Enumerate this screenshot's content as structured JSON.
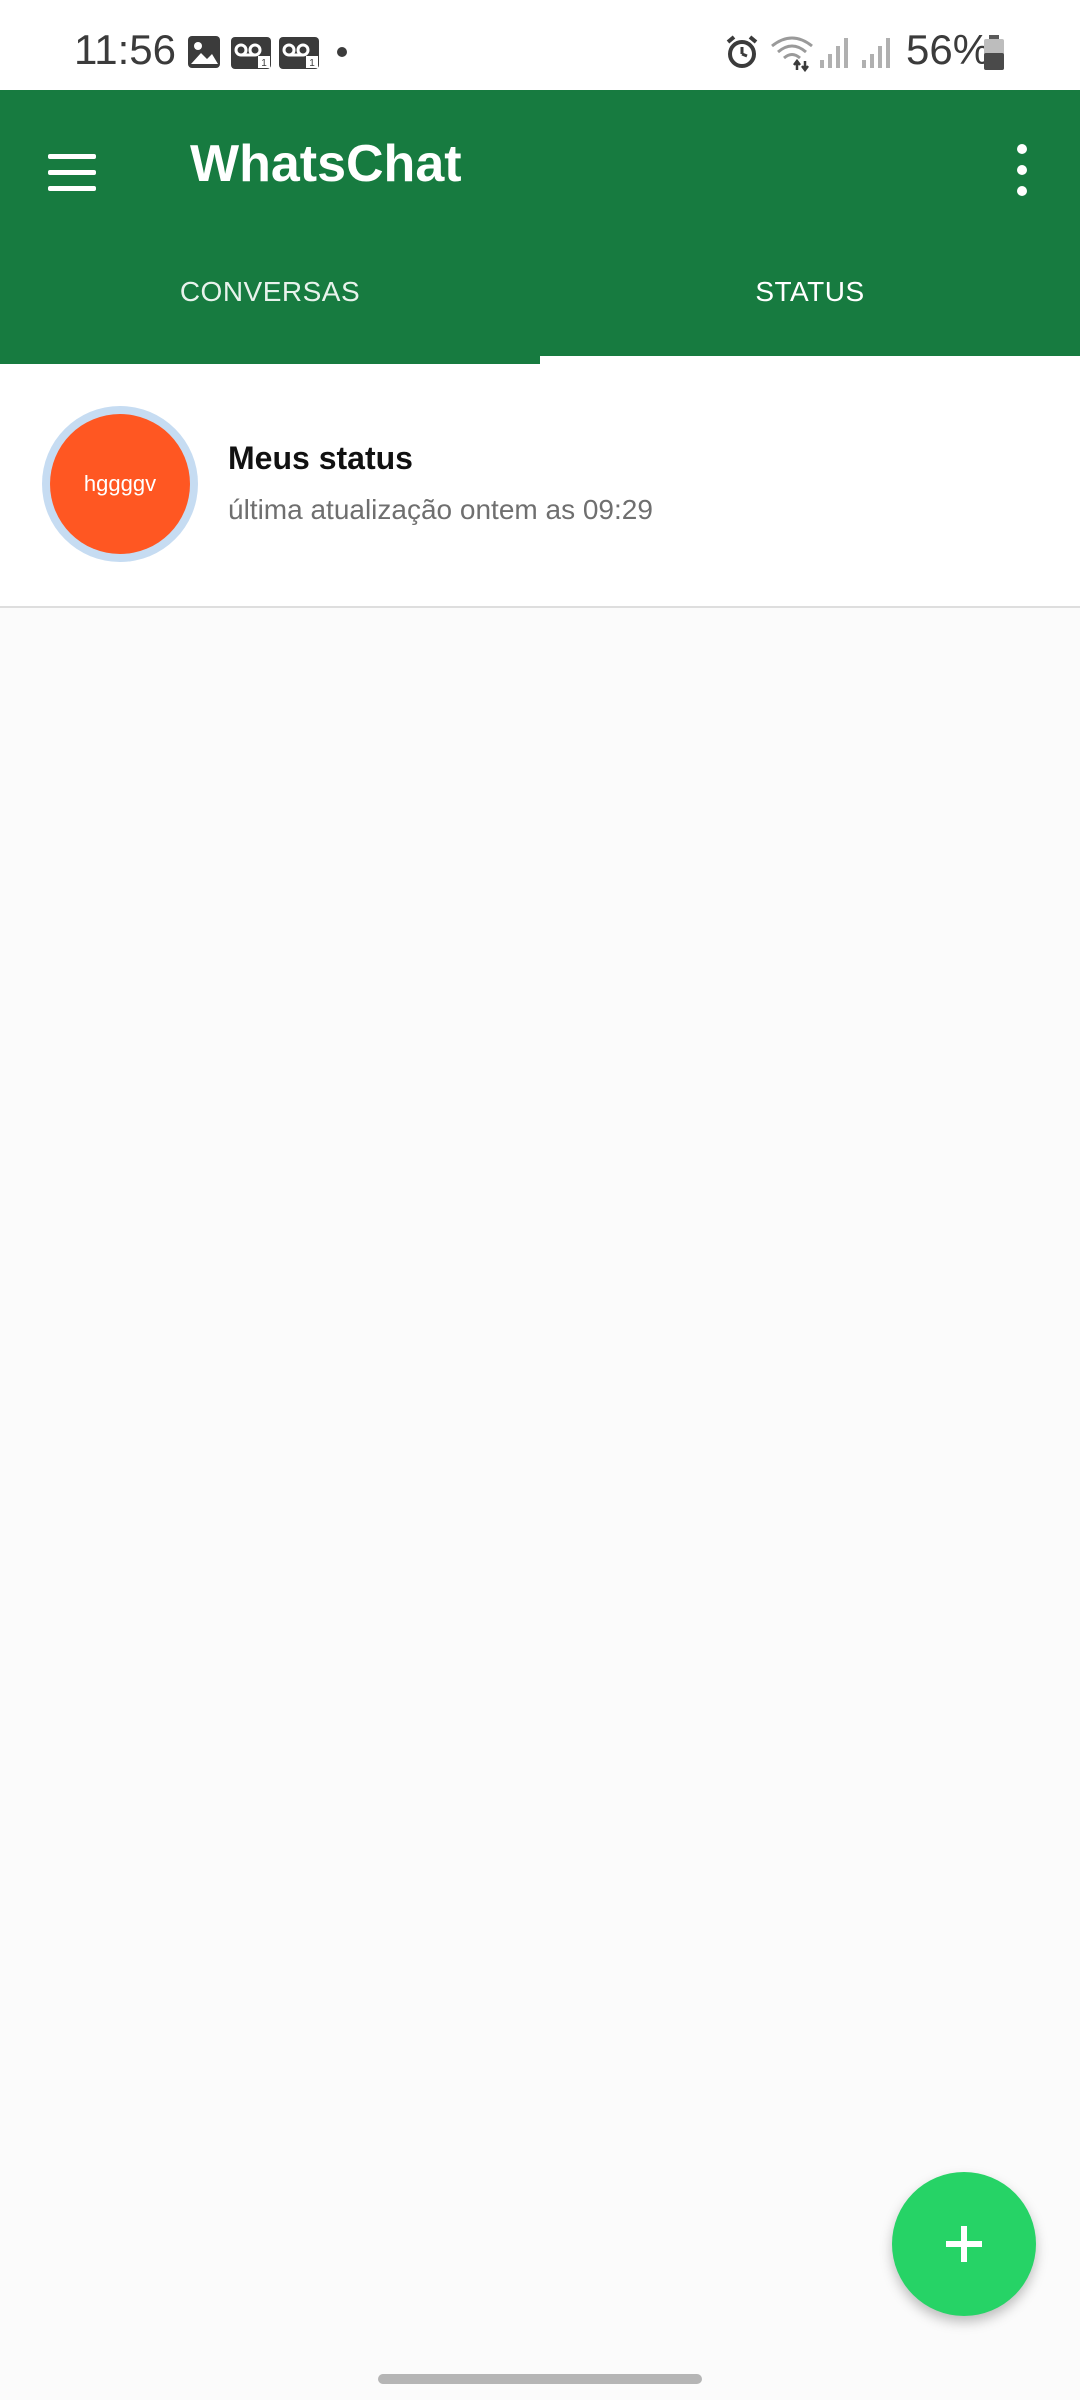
{
  "status_bar": {
    "time": "11:56",
    "battery_percent": "56%",
    "icons": [
      "image-icon",
      "voicemail-icon",
      "voicemail-icon",
      "notification-dot-icon",
      "alarm-icon",
      "wifi-icon",
      "signal-icon",
      "signal-icon",
      "battery-icon"
    ]
  },
  "app_bar": {
    "title": "WhatsChat",
    "color": "#177b40",
    "tabs": [
      {
        "label": "CONVERSAS",
        "selected": false
      },
      {
        "label": "STATUS",
        "selected": true
      }
    ]
  },
  "status_list": {
    "my_status": {
      "avatar_text": "hggggv",
      "avatar_color": "#ff5722",
      "title": "Meus status",
      "subtitle": "última atualização ontem as 09:29"
    }
  },
  "fab": {
    "icon": "plus-icon",
    "color": "#26d366"
  }
}
